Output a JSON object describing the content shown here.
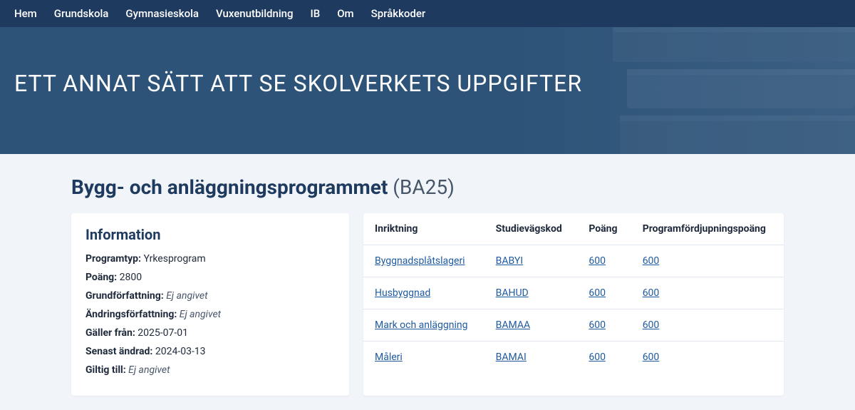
{
  "nav": {
    "items": [
      {
        "label": "Hem"
      },
      {
        "label": "Grundskola"
      },
      {
        "label": "Gymnasieskola"
      },
      {
        "label": "Vuxenutbildning"
      },
      {
        "label": "IB"
      },
      {
        "label": "Om"
      },
      {
        "label": "Språkkoder"
      }
    ]
  },
  "hero": {
    "title": "ETT ANNAT SÄTT ATT SE SKOLVERKETS UPPGIFTER"
  },
  "page": {
    "program_name": "Bygg- och anläggningsprogrammet",
    "program_code": "(BA25)"
  },
  "info": {
    "heading": "Information",
    "rows": [
      {
        "label": "Programtyp:",
        "value": "Yrkesprogram",
        "italic": false
      },
      {
        "label": "Poäng:",
        "value": "2800",
        "italic": false
      },
      {
        "label": "Grundförfattning:",
        "value": "Ej angivet",
        "italic": true
      },
      {
        "label": "Ändringsförfattning:",
        "value": "Ej angivet",
        "italic": true
      },
      {
        "label": "Gäller från:",
        "value": "2025-07-01",
        "italic": false
      },
      {
        "label": "Senast ändrad:",
        "value": "2024-03-13",
        "italic": false
      },
      {
        "label": "Giltig till:",
        "value": "Ej angivet",
        "italic": true
      }
    ]
  },
  "table": {
    "headers": {
      "inriktning": "Inriktning",
      "studievagskod": "Studievägskod",
      "poang": "Poäng",
      "programfordjupning": "Programfördjupningspoäng"
    },
    "rows": [
      {
        "inriktning": "Byggnadsplåtslageri",
        "kod": "BABYI",
        "poang": "600",
        "pfp": "600"
      },
      {
        "inriktning": "Husbyggnad",
        "kod": "BAHUD",
        "poang": "600",
        "pfp": "600"
      },
      {
        "inriktning": "Mark och anläggning",
        "kod": "BAMAA",
        "poang": "600",
        "pfp": "600"
      },
      {
        "inriktning": "Måleri",
        "kod": "BAMAI",
        "poang": "600",
        "pfp": "600"
      }
    ]
  }
}
